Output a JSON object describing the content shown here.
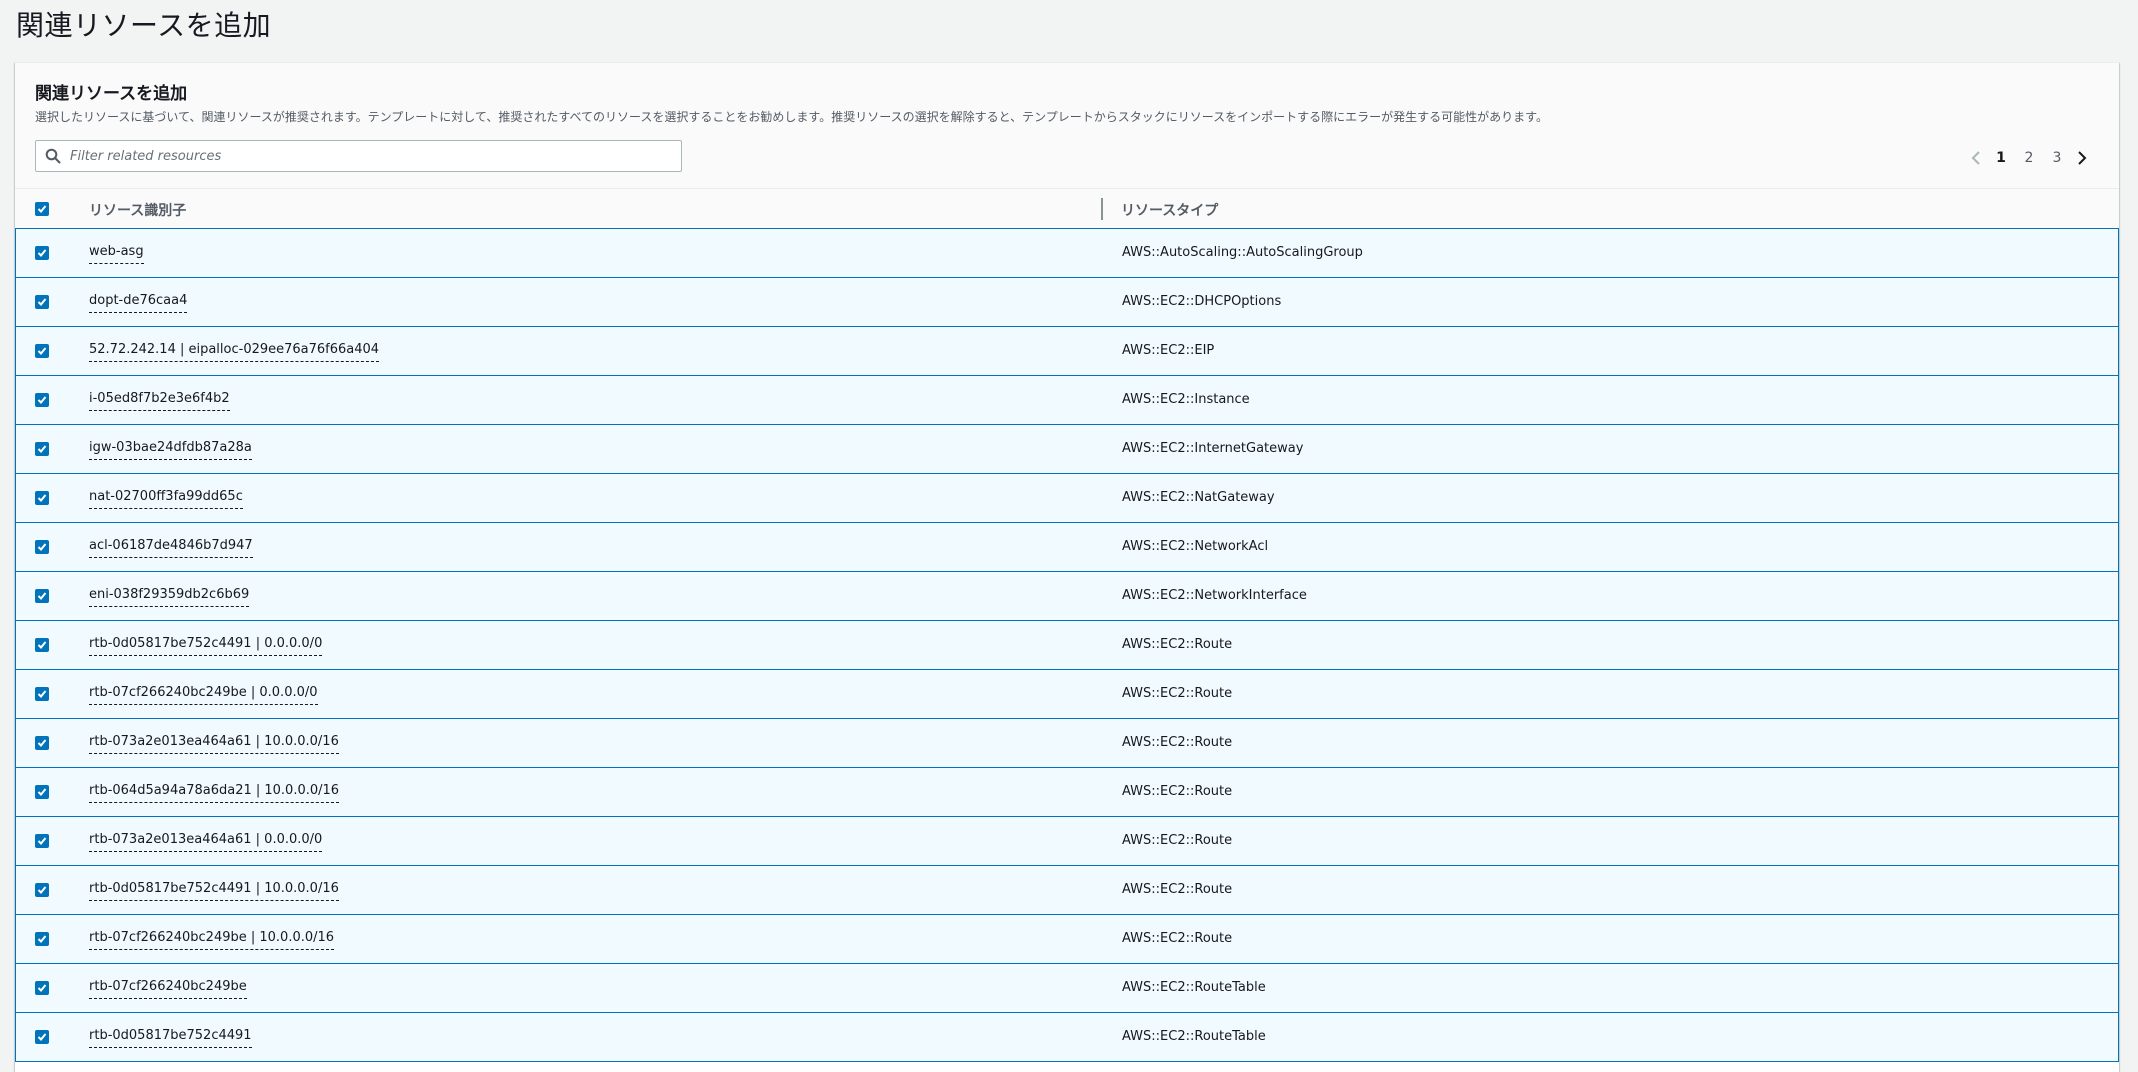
{
  "page": {
    "title": "関連リソースを追加"
  },
  "panel": {
    "title": "関連リソースを追加",
    "description": "選択したリソースに基づいて、関連リソースが推奨されます。テンプレートに対して、推奨されたすべてのリソースを選択することをお勧めします。推奨リソースの選択を解除すると、テンプレートからスタックにリソースをインポートする際にエラーが発生する可能性があります。"
  },
  "filter": {
    "placeholder": "Filter related resources",
    "value": ""
  },
  "pagination": {
    "pages": [
      "1",
      "2",
      "3"
    ],
    "current": "1"
  },
  "table": {
    "columns": {
      "identifier": "リソース識別子",
      "type": "リソースタイプ"
    },
    "rows": [
      {
        "id": "web-asg",
        "type": "AWS::AutoScaling::AutoScalingGroup",
        "checked": true
      },
      {
        "id": "dopt-de76caa4",
        "type": "AWS::EC2::DHCPOptions",
        "checked": true
      },
      {
        "id": "52.72.242.14 | eipalloc-029ee76a76f66a404",
        "type": "AWS::EC2::EIP",
        "checked": true
      },
      {
        "id": "i-05ed8f7b2e3e6f4b2",
        "type": "AWS::EC2::Instance",
        "checked": true
      },
      {
        "id": "igw-03bae24dfdb87a28a",
        "type": "AWS::EC2::InternetGateway",
        "checked": true
      },
      {
        "id": "nat-02700ff3fa99dd65c",
        "type": "AWS::EC2::NatGateway",
        "checked": true
      },
      {
        "id": "acl-06187de4846b7d947",
        "type": "AWS::EC2::NetworkAcl",
        "checked": true
      },
      {
        "id": "eni-038f29359db2c6b69",
        "type": "AWS::EC2::NetworkInterface",
        "checked": true
      },
      {
        "id": "rtb-0d05817be752c4491 | 0.0.0.0/0",
        "type": "AWS::EC2::Route",
        "checked": true
      },
      {
        "id": "rtb-07cf266240bc249be | 0.0.0.0/0",
        "type": "AWS::EC2::Route",
        "checked": true
      },
      {
        "id": "rtb-073a2e013ea464a61 | 10.0.0.0/16",
        "type": "AWS::EC2::Route",
        "checked": true
      },
      {
        "id": "rtb-064d5a94a78a6da21 | 10.0.0.0/16",
        "type": "AWS::EC2::Route",
        "checked": true
      },
      {
        "id": "rtb-073a2e013ea464a61 | 0.0.0.0/0",
        "type": "AWS::EC2::Route",
        "checked": true
      },
      {
        "id": "rtb-0d05817be752c4491 | 10.0.0.0/16",
        "type": "AWS::EC2::Route",
        "checked": true
      },
      {
        "id": "rtb-07cf266240bc249be | 10.0.0.0/16",
        "type": "AWS::EC2::Route",
        "checked": true
      },
      {
        "id": "rtb-07cf266240bc249be",
        "type": "AWS::EC2::RouteTable",
        "checked": true
      },
      {
        "id": "rtb-0d05817be752c4491",
        "type": "AWS::EC2::RouteTable",
        "checked": true
      }
    ]
  },
  "colors": {
    "accent": "#0073bb",
    "row_selected_bg": "#f1faff",
    "page_bg": "#f2f3f3"
  },
  "icons": {
    "search": "search-icon",
    "prev": "chevron-left-icon",
    "next": "chevron-right-icon",
    "check": "check-icon"
  }
}
